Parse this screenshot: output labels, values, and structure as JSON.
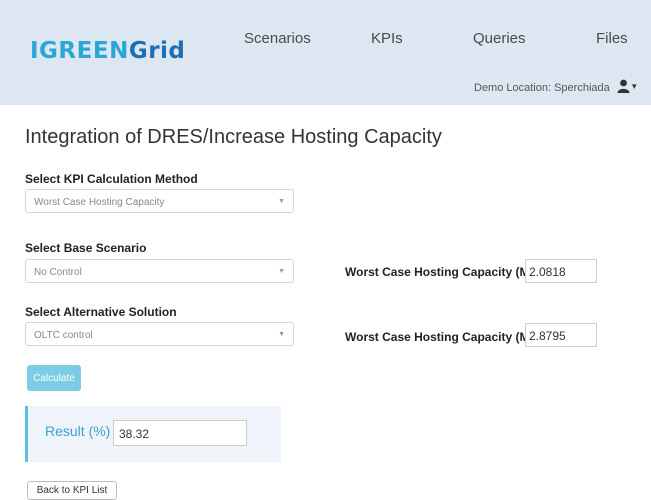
{
  "nav": {
    "logo": {
      "part1": "IGREEN",
      "part2": "Grid"
    },
    "items": [
      "Scenarios",
      "KPIs",
      "Queries",
      "Files"
    ],
    "location": "Demo Location: Sperchiada",
    "user_icon": "user-icon"
  },
  "page": {
    "title": "Integration of DRES/Increase Hosting Capacity"
  },
  "form": {
    "method_label": "Select KPI Calculation Method",
    "method_value": "Worst Case Hosting Capacity",
    "base_label": "Select Base Scenario",
    "base_value": "No Control",
    "alt_label": "Select Alternative Solution",
    "alt_value": "OLTC control",
    "kpi_base_label": "Worst Case Hosting Capacity (MW)",
    "kpi_base_value": "2.0818",
    "kpi_alt_label": "Worst Case Hosting Capacity (MW)",
    "kpi_alt_value": "2.8795",
    "calculate_label": "Calculate"
  },
  "result": {
    "label": "Result (%)",
    "value": "38.32"
  },
  "back_label": "Back to KPI List",
  "colors": {
    "navbar_bg": "#dde7f1",
    "accent": "#5bc0de",
    "result_text": "#3aa3cf"
  }
}
